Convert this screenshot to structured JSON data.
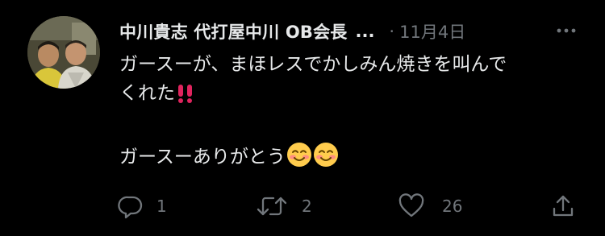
{
  "tweet": {
    "author": {
      "display_name": "中川貴志 代打屋中川 OB会長",
      "truncation": "..."
    },
    "separator": "·",
    "date": "11月4日",
    "lines": [
      "ガースーが、まほレスでかしみん焼きを叫んで",
      "くれた",
      "ガースーありがとう"
    ],
    "emoji": {
      "double_exclamation": "‼️",
      "smiling_face": "😊"
    },
    "actions": {
      "reply_count": "1",
      "retweet_count": "2",
      "like_count": "26"
    }
  },
  "colors": {
    "background": "#000000",
    "primary_text": "#e7e9ea",
    "secondary_text": "#71767b",
    "exclamation_red": "#e0245e"
  },
  "icons": [
    "avatar-photo",
    "more-options-icon",
    "reply-icon",
    "retweet-icon",
    "like-icon",
    "share-icon"
  ]
}
